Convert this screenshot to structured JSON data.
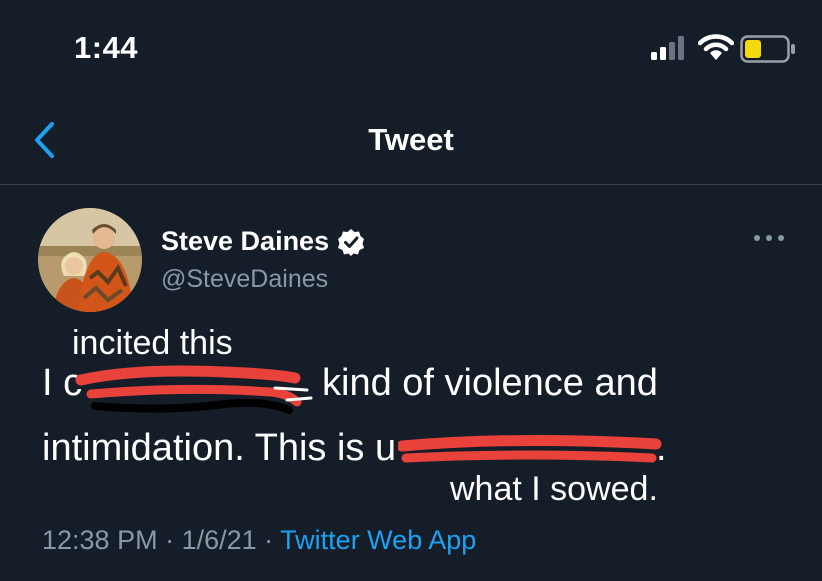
{
  "status_bar": {
    "time": "1:44"
  },
  "nav": {
    "title": "Tweet"
  },
  "tweet": {
    "author_name": "Steve Daines",
    "handle": "@SteveDaines",
    "line1_visible_start": "I c",
    "line1_visible_end": "kind of violence and",
    "line2_visible": "intimidation. This is u",
    "line2_end": ".",
    "time": "12:38 PM",
    "separator": " · ",
    "date": "1/6/21",
    "app": "Twitter Web App"
  },
  "annotations": {
    "top_insert": "incited this",
    "bottom_insert": "what I sowed."
  },
  "colors": {
    "background": "#151d28",
    "accent": "#1da1f2",
    "secondary_text": "#8899a6",
    "redaction": "#e8423b",
    "battery_low": "#f5d80e"
  }
}
